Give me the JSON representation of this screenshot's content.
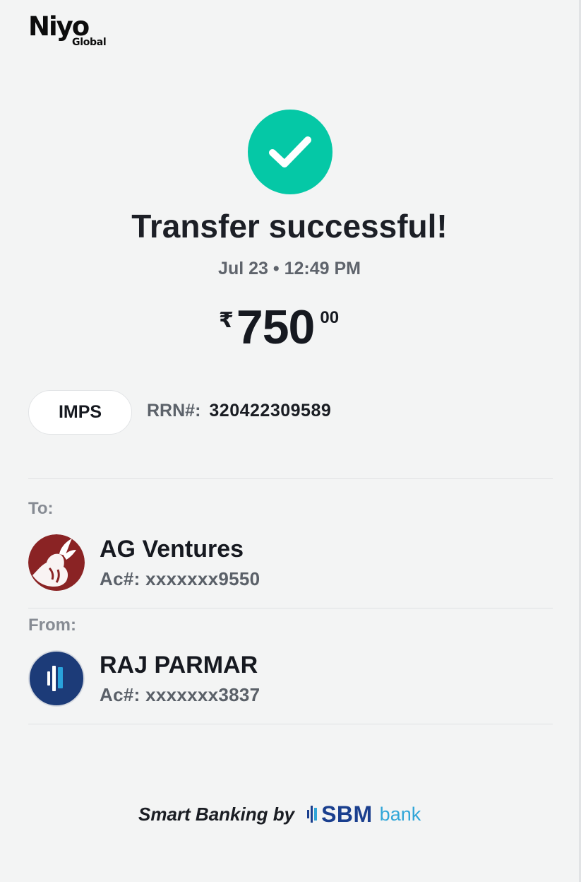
{
  "brand": {
    "logo_main": "Niyo",
    "logo_sub": "Global"
  },
  "status": {
    "title": "Transfer successful!",
    "datetime": "Jul 23 • 12:49 PM",
    "icon": "check-icon",
    "accent": "#05c8a6"
  },
  "amount": {
    "currency": "₹",
    "integer": "750",
    "decimal": "00"
  },
  "reference": {
    "mode": "IMPS",
    "rrn_label": "RRN#:",
    "rrn_value": "320422309589"
  },
  "to": {
    "label": "To:",
    "name": "AG Ventures",
    "account": "Ac#: xxxxxxx9550",
    "avatar": "goat-logo-avatar"
  },
  "from": {
    "label": "From:",
    "name": "RAJ PARMAR",
    "account": "Ac#: xxxxxxx3837",
    "avatar": "bank-logo-avatar"
  },
  "footer": {
    "text": "Smart Banking by",
    "bank_brand": "SBM",
    "bank_suffix": "bank"
  }
}
